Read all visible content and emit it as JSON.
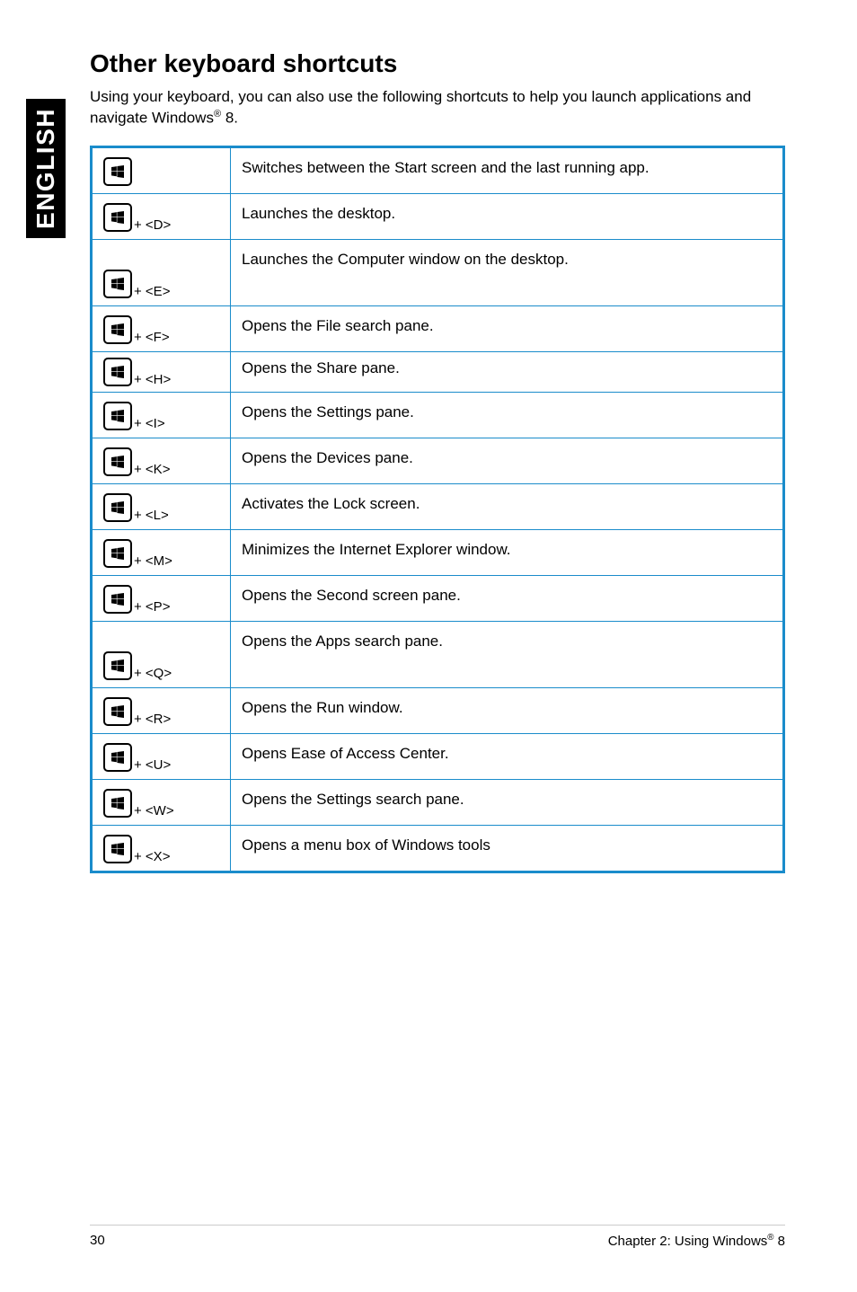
{
  "side_label": "ENGLISH",
  "heading": "Other keyboard shortcuts",
  "intro_pre": "Using your keyboard, you can also use the following shortcuts to help you launch applications and navigate Windows",
  "intro_post": " 8.",
  "rows": [
    {
      "combo": "",
      "desc": "Switches between the Start screen and the last running app."
    },
    {
      "combo": " + <D>",
      "desc": "Launches the desktop."
    },
    {
      "combo": " + <E>",
      "desc": "Launches the Computer window on the desktop."
    },
    {
      "combo": " + <F>",
      "desc": "Opens the File search pane."
    },
    {
      "combo": " + <H>",
      "desc": "Opens the Share pane."
    },
    {
      "combo": " + <I>",
      "desc": "Opens the Settings pane."
    },
    {
      "combo": " + <K>",
      "desc": "Opens the Devices pane."
    },
    {
      "combo": " + <L>",
      "desc": "Activates the Lock screen."
    },
    {
      "combo": " + <M>",
      "desc": "Minimizes the Internet Explorer window."
    },
    {
      "combo": " + <P>",
      "desc": "Opens the Second screen pane."
    },
    {
      "combo": " + <Q>",
      "desc": "Opens the Apps search pane."
    },
    {
      "combo": " + <R>",
      "desc": "Opens the Run window."
    },
    {
      "combo": " + <U>",
      "desc": "Opens Ease of Access Center."
    },
    {
      "combo": " + <W>",
      "desc": "Opens the Settings search pane."
    },
    {
      "combo": " + <X>",
      "desc": "Opens a menu box of Windows tools"
    }
  ],
  "footer": {
    "page_num": "30",
    "chapter_pre": "Chapter 2: Using Windows",
    "chapter_post": " 8"
  }
}
